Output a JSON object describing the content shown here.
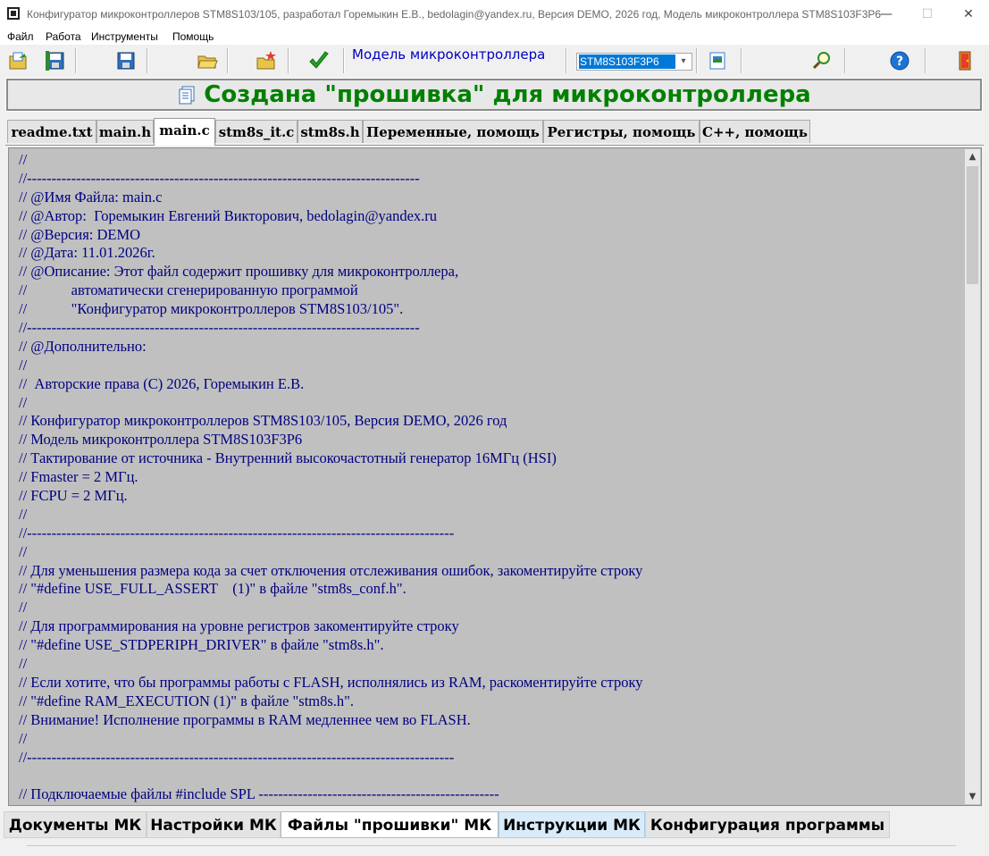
{
  "window": {
    "title": "Конфигуратор микроконтроллеров STM8S103/105, разработал Горемыкин Е.В., bedolagin@yandex.ru, Версия DEMO, 2026 год, Модель микроконтроллера STM8S103F3P6",
    "min_glyph": "—",
    "max_glyph": "☐",
    "close_glyph": "✕"
  },
  "menu": {
    "items": [
      {
        "label": "Файл"
      },
      {
        "label": "Работа"
      },
      {
        "label": "Инструменты"
      },
      {
        "label": "Помощь"
      }
    ]
  },
  "toolbar": {
    "model_label": "Модель микроконтроллера",
    "model_value": "STM8S103F3P6",
    "icons": [
      "open-project-icon",
      "save-all-icon",
      "save-icon",
      "open-folder-icon",
      "new-project-icon",
      "generate-check-icon",
      "device-info-icon",
      "search-refresh-icon",
      "help-icon",
      "exit-icon"
    ]
  },
  "banner": {
    "text": "Создана \"прошивка\" для микроконтроллера"
  },
  "file_tabs": [
    {
      "label": "readme.txt"
    },
    {
      "label": "main.h"
    },
    {
      "label": "main.c"
    },
    {
      "label": "stm8s_it.c"
    },
    {
      "label": "stm8s.h"
    },
    {
      "label": "Переменные, помощь"
    },
    {
      "label": "Регистры, помощь"
    },
    {
      "label": "C++, помощь"
    }
  ],
  "active_file_tab": "main.c",
  "code_lines": [
    "//",
    "//--------------------------------------------------------------------------------",
    "// @Имя Файла: main.c",
    "// @Автор:  Горемыкин Евгений Викторович, bedolagin@yandex.ru",
    "// @Версия: DEMO",
    "// @Дата: 11.01.2026г.",
    "// @Описание: Этот файл содержит прошивку для микроконтроллера,",
    "//            автоматически сгенерированную программой",
    "//            \"Конфигуратор микроконтроллеров STM8S103/105\".",
    "//--------------------------------------------------------------------------------",
    "// @Дополнительно:",
    "//",
    "//  Авторские права (C) 2026, Горемыкин Е.В.",
    "//",
    "// Конфигуратор микроконтроллеров STM8S103/105, Версия DEMO, 2026 год",
    "// Модель микроконтроллера STM8S103F3P6",
    "// Тактирование от источника - Внутренний высокочастотный генератор 16МГц (HSI)",
    "// Fmaster = 2 МГц.",
    "// FCPU = 2 МГц.",
    "//",
    "//---------------------------------------------------------------------------------------",
    "//",
    "// Для уменьшения размера кода за счет отключения отслеживания ошибок, закоментируйте строку",
    "// \"#define USE_FULL_ASSERT    (1)\" в файле \"stm8s_conf.h\".",
    "//",
    "// Для программирования на уровне регистров закоментируйте строку",
    "// \"#define USE_STDPERIPH_DRIVER\" в файле \"stm8s.h\".",
    "//",
    "// Если хотите, что бы программы работы с FLASH, исполнялись из RAM, раскоментируйте строку",
    "// \"#define RAM_EXECUTION (1)\" в файле \"stm8s.h\".",
    "// Внимание! Исполнение программы в RAM медленнее чем во FLASH.",
    "//",
    "//---------------------------------------------------------------------------------------",
    "",
    "// Подключаемые файлы #include SPL -------------------------------------------------"
  ],
  "bottom_tabs": [
    {
      "label": "Документы МК"
    },
    {
      "label": "Настройки МК"
    },
    {
      "label": "Файлы \"прошивки\" МК"
    },
    {
      "label": "Инструкции МК"
    },
    {
      "label": "Конфигурация программы"
    }
  ],
  "active_bottom_tab": "Файлы \"прошивки\" МК",
  "colors": {
    "banner_text": "#008000",
    "code_text": "#000080",
    "editor_bg": "#c0c0c0",
    "model_label": "#0000c0",
    "select_highlight": "#0078d7"
  }
}
